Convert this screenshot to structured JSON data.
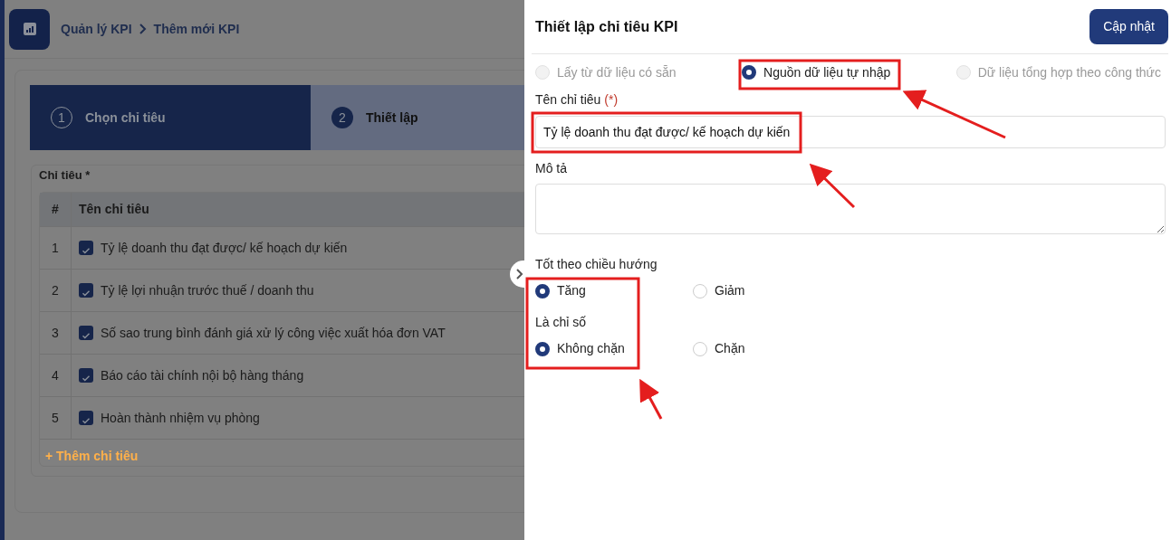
{
  "breadcrumb": [
    {
      "label": "Quản lý KPI"
    },
    {
      "label": "Thêm mới KPI"
    }
  ],
  "steps": [
    {
      "number": "1",
      "label": "Chọn chỉ tiêu",
      "selected": false
    },
    {
      "number": "2",
      "label": "Thiết lập",
      "selected": true
    }
  ],
  "indicators": {
    "title": "Chỉ tiêu *",
    "columns": [
      "#",
      "Tên chỉ tiêu"
    ],
    "rows": [
      {
        "index": "1",
        "name": "Tỷ lệ doanh thu đạt được/ kế hoạch dự kiến",
        "checked": true
      },
      {
        "index": "2",
        "name": "Tỷ lệ lợi nhuận trước thuế / doanh thu",
        "checked": true
      },
      {
        "index": "3",
        "name": "Số sao trung bình đánh giá xử lý công việc xuất hóa đơn VAT",
        "checked": true
      },
      {
        "index": "4",
        "name": "Báo cáo tài chính nội bộ hàng tháng",
        "checked": true
      },
      {
        "index": "5",
        "name": "Hoàn thành nhiệm vụ phòng",
        "checked": true
      }
    ],
    "add_link": "+ Thêm chỉ tiêu"
  },
  "drawer": {
    "title": "Thiết lập chỉ tiêu KPI",
    "update_button": "Cập nhật",
    "sources": [
      {
        "label": "Lấy từ dữ liệu có sẵn",
        "selected": false,
        "disabled": true
      },
      {
        "label": "Nguồn dữ liệu tự nhập",
        "selected": true,
        "disabled": false
      },
      {
        "label": "Dữ liệu tổng hợp theo công thức",
        "selected": false,
        "disabled": true
      }
    ],
    "name_field": {
      "label": "Tên chỉ tiêu",
      "required_mark": "(*)",
      "value": "Tỷ lệ doanh thu đạt được/ kế hoạch dự kiến"
    },
    "description_field": {
      "label": "Mô tả"
    },
    "direction": {
      "label": "Tốt theo chiều hướng",
      "options": [
        {
          "label": "Tăng",
          "selected": true
        },
        {
          "label": "Giảm",
          "selected": false
        }
      ]
    },
    "index_type": {
      "label": "Là chỉ số",
      "options": [
        {
          "label": "Không chặn",
          "selected": true
        },
        {
          "label": "Chặn",
          "selected": false
        }
      ]
    }
  }
}
